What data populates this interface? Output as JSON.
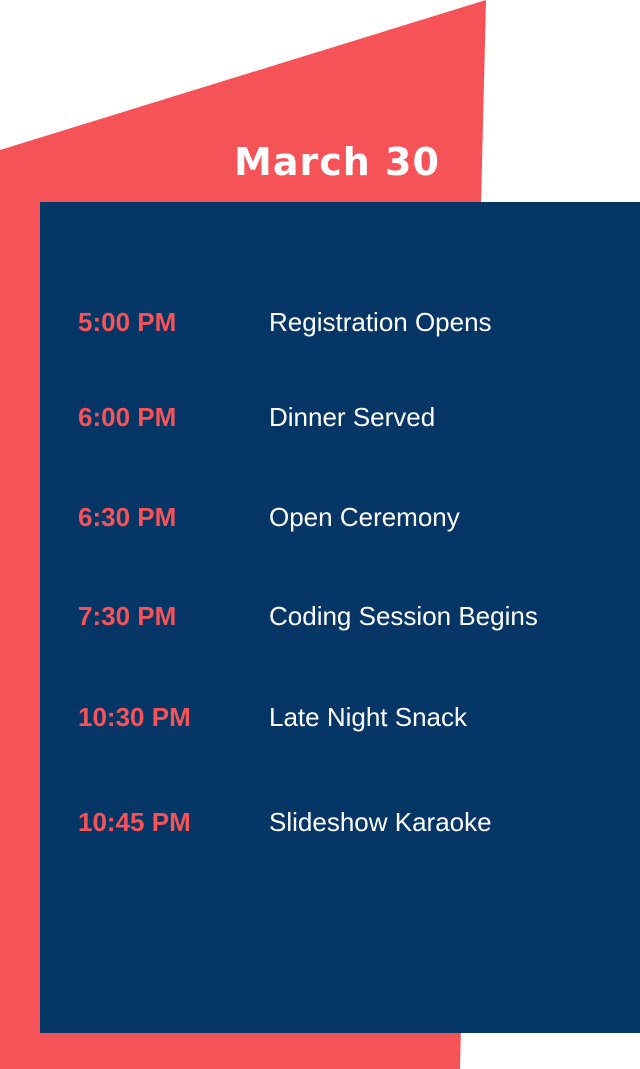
{
  "schedule": {
    "date": "March 30",
    "events": [
      {
        "time": "5:00 PM",
        "name": "Registration Opens"
      },
      {
        "time": "6:00 PM",
        "name": "Dinner Served"
      },
      {
        "time": "6:30 PM",
        "name": "Open Ceremony"
      },
      {
        "time": "7:30 PM",
        "name": "Coding Session Begins"
      },
      {
        "time": "10:30 PM",
        "name": "Late Night Snack"
      },
      {
        "time": "10:45 PM",
        "name": "Slideshow Karaoke"
      }
    ]
  },
  "colors": {
    "accent_red": "#f65358",
    "panel_navy": "#053665",
    "text_white": "#ffffff",
    "background": "#ffffff"
  }
}
